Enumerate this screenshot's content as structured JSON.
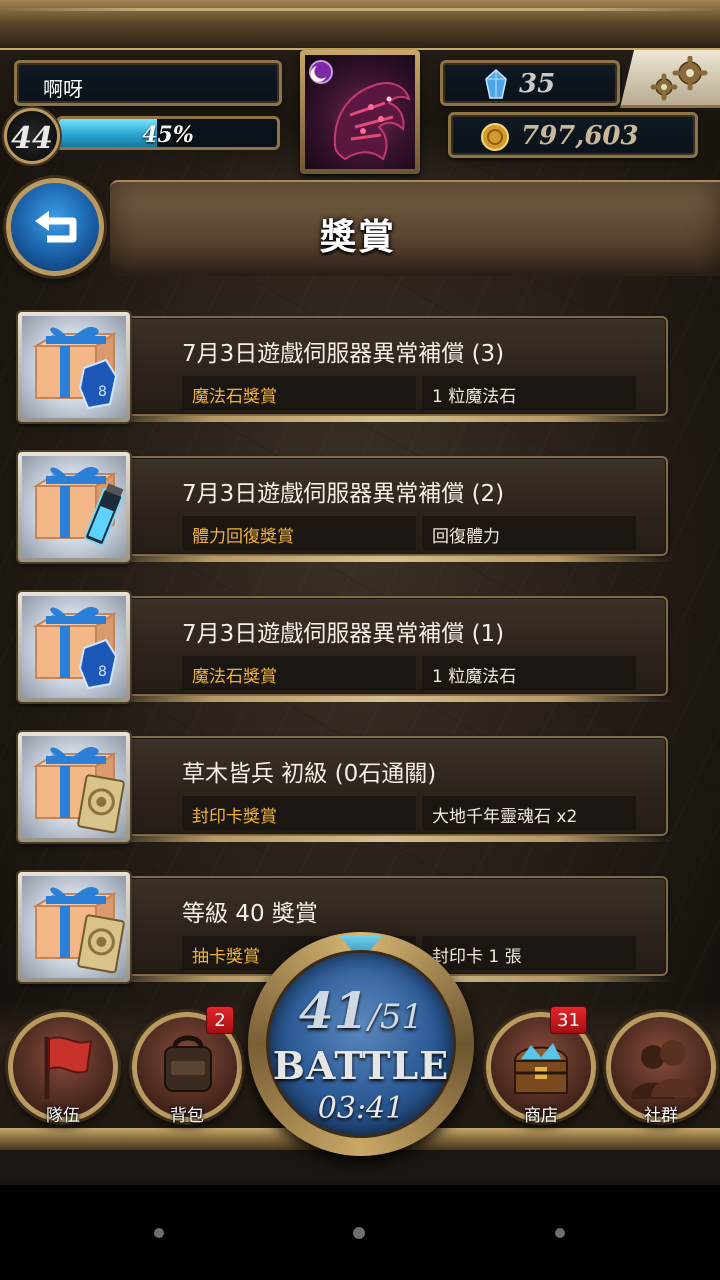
{
  "header": {
    "player_name": "啊呀",
    "level": "44",
    "exp_percent_label": "45%",
    "exp_fraction": 0.45,
    "gems": "35",
    "coins": "797,603"
  },
  "page": {
    "title": "獎賞"
  },
  "rewards": [
    {
      "title": "7月3日遊戲伺服器異常補償 (3)",
      "type": "魔法石獎賞",
      "detail": "1 粒魔法石",
      "icon": "gift-box-with-magic-stone-icon"
    },
    {
      "title": "7月3日遊戲伺服器異常補償 (2)",
      "type": "體力回復獎賞",
      "detail": "回復體力",
      "icon": "gift-box-with-stamina-potion-icon"
    },
    {
      "title": "7月3日遊戲伺服器異常補償 (1)",
      "type": "魔法石獎賞",
      "detail": "1 粒魔法石",
      "icon": "gift-box-with-magic-stone-icon"
    },
    {
      "title": "草木皆兵 初級 (0石通關)",
      "type": "封印卡獎賞",
      "detail": "大地千年靈魂石 x2",
      "icon": "gift-box-with-seal-card-icon"
    },
    {
      "title": "等級 40 獎賞",
      "type": "抽卡獎賞",
      "detail": "封印卡 1 張",
      "icon": "gift-box-with-seal-card-icon"
    }
  ],
  "bottom_nav": {
    "team_label": "隊伍",
    "bag_label": "背包",
    "bag_badge": "2",
    "shop_label": "商店",
    "shop_badge": "31",
    "social_label": "社群",
    "battle": {
      "stamina_current": "41",
      "stamina_sep": "/",
      "stamina_max": "51",
      "label": "BATTLE",
      "timer": "03:41"
    }
  },
  "colors": {
    "accent_gold": "#c9a866",
    "reward_type_text": "#f1b33b",
    "exp_fill": "#2aa6d0",
    "badge_red": "#d21c22"
  }
}
